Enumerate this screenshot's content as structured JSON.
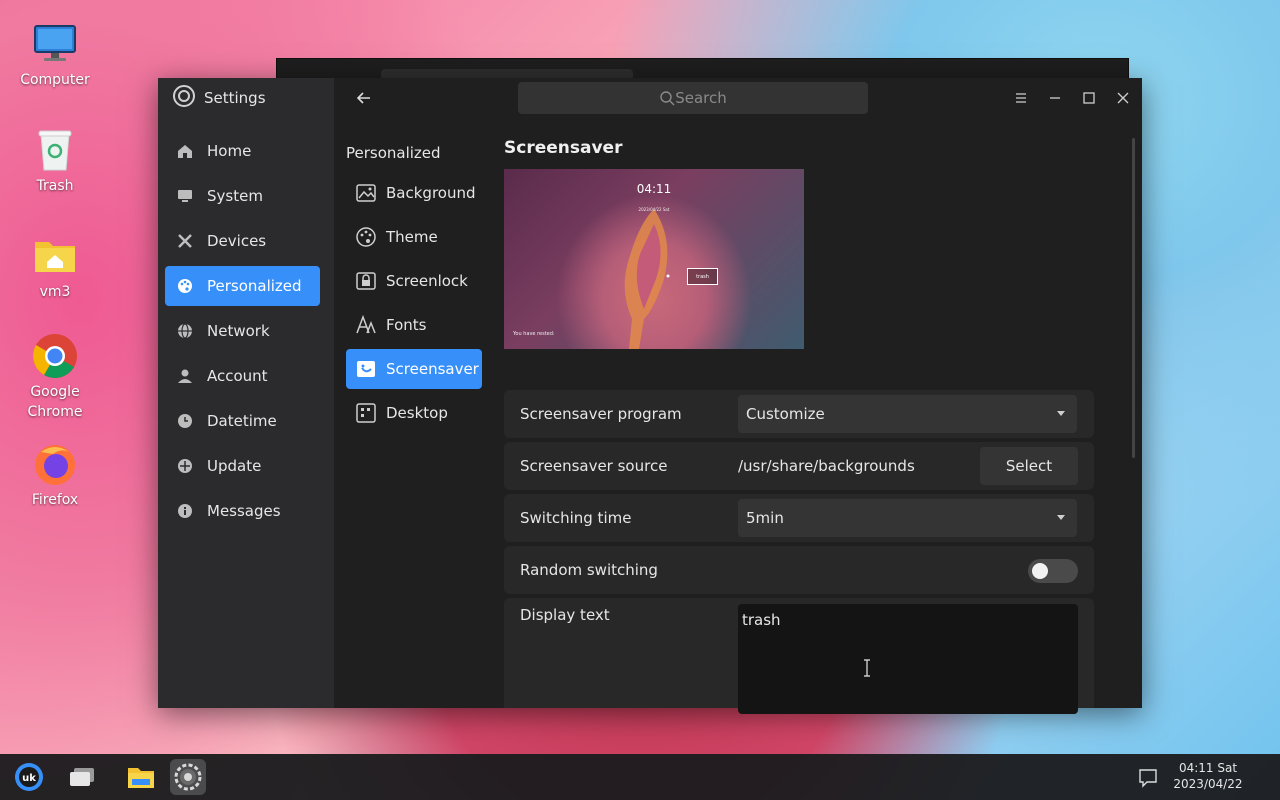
{
  "desktop": {
    "icons": [
      {
        "label": "Computer"
      },
      {
        "label": "Trash"
      },
      {
        "label": "vm3"
      },
      {
        "label": "Google Chrome"
      },
      {
        "label": "Firefox"
      }
    ]
  },
  "settings": {
    "app_title": "Settings",
    "search_placeholder": "Search",
    "nav": [
      {
        "label": "Home",
        "icon": "home-icon"
      },
      {
        "label": "System",
        "icon": "monitor-icon"
      },
      {
        "label": "Devices",
        "icon": "tools-icon"
      },
      {
        "label": "Personalized",
        "icon": "palette-icon",
        "active": true
      },
      {
        "label": "Network",
        "icon": "globe-icon"
      },
      {
        "label": "Account",
        "icon": "person-icon"
      },
      {
        "label": "Datetime",
        "icon": "clock-icon"
      },
      {
        "label": "Update",
        "icon": "update-icon"
      },
      {
        "label": "Messages",
        "icon": "info-icon"
      }
    ],
    "subnav_title": "Personalized",
    "subnav": [
      {
        "label": "Background",
        "icon": "image-icon"
      },
      {
        "label": "Theme",
        "icon": "palette-icon"
      },
      {
        "label": "Screenlock",
        "icon": "screenlock-icon"
      },
      {
        "label": "Fonts",
        "icon": "font-icon"
      },
      {
        "label": "Screensaver",
        "icon": "screensaver-icon",
        "active": true
      },
      {
        "label": "Desktop",
        "icon": "desktop-grid-icon"
      }
    ],
    "section_title": "Screensaver",
    "preview": {
      "clock": "04:11",
      "date": "2023/04/22 Sat",
      "label": "trash",
      "rest_text": "You have rested:"
    },
    "rows": {
      "program": {
        "label": "Screensaver program",
        "value": "Customize"
      },
      "source": {
        "label": "Screensaver source",
        "value": "/usr/share/backgrounds",
        "button": "Select"
      },
      "switch_time": {
        "label": "Switching time",
        "value": "5min"
      },
      "random": {
        "label": "Random switching",
        "enabled": false
      },
      "display_text": {
        "label": "Display text",
        "value": "trash"
      }
    }
  },
  "taskbar": {
    "time": "04:11 Sat",
    "date": "2023/04/22"
  },
  "colors": {
    "accent": "#3790fa",
    "window_bg": "#1f1f1f",
    "nav_bg": "#2c2c2e"
  }
}
